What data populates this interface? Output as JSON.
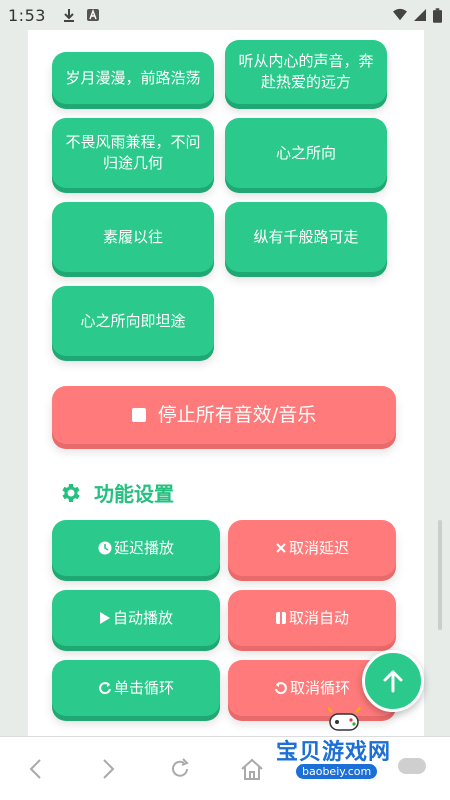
{
  "status_bar": {
    "time": "1:53"
  },
  "sounds": [
    "岁月漫漫，前路浩荡",
    "听从内心的声音，奔赴热爱的远方",
    "不畏风雨兼程，不问归途几何",
    "心之所向",
    "素履以往",
    "纵有千般路可走",
    "心之所向即坦途"
  ],
  "stop_button": "停止所有音效/音乐",
  "section": {
    "title": "功能设置",
    "icon": "gear-icon"
  },
  "functions": {
    "delay_play": "延迟播放",
    "cancel_delay": "取消延迟",
    "auto_play": "自动播放",
    "cancel_auto": "取消自动",
    "single_loop": "单击循环",
    "cancel_loop": "取消循环"
  },
  "watermark": {
    "name": "宝贝游戏网",
    "url": "baobeiy.com"
  },
  "colors": {
    "green": "#2bc98b",
    "red": "#ff7a7a",
    "accent_text": "#23c07f"
  }
}
